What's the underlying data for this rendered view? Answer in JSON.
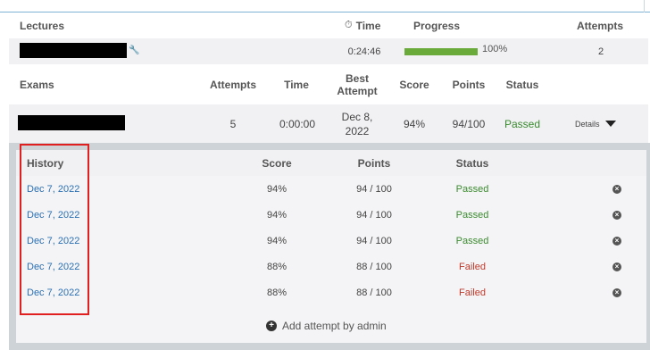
{
  "lectures_header": {
    "title": "Lectures",
    "time": "Time",
    "progress": "Progress",
    "attempts": "Attempts"
  },
  "lecture_row": {
    "time": "0:24:46",
    "progress_value": 100,
    "progress_text": "100%",
    "attempts": "2"
  },
  "exams_header": {
    "title": "Exams",
    "attempts": "Attempts",
    "time": "Time",
    "best_attempt_line1": "Best",
    "best_attempt_line2": "Attempt",
    "score": "Score",
    "points": "Points",
    "status": "Status"
  },
  "exam_row": {
    "attempts": "5",
    "time": "0:00:00",
    "best_attempt_line1": "Dec 8,",
    "best_attempt_line2": "2022",
    "score": "94%",
    "points": "94/100",
    "status": "Passed",
    "details_label": "Details"
  },
  "history_header": {
    "title": "History",
    "score": "Score",
    "points": "Points",
    "status": "Status"
  },
  "history_rows": [
    {
      "date": "Dec 7, 2022",
      "score": "94%",
      "points": "94 / 100",
      "status": "Passed"
    },
    {
      "date": "Dec 7, 2022",
      "score": "94%",
      "points": "94 / 100",
      "status": "Passed"
    },
    {
      "date": "Dec 7, 2022",
      "score": "94%",
      "points": "94 / 100",
      "status": "Passed"
    },
    {
      "date": "Dec 7, 2022",
      "score": "88%",
      "points": "88 / 100",
      "status": "Failed"
    },
    {
      "date": "Dec 7, 2022",
      "score": "88%",
      "points": "88 / 100",
      "status": "Failed"
    }
  ],
  "add_attempt_label": "Add attempt by admin",
  "colors": {
    "progress_bar": "#6aaa3a",
    "passed": "#3a8a2e",
    "failed": "#c0392b",
    "link": "#2a6fb0",
    "highlight": "#e02020"
  },
  "icons": {
    "time": "stopwatch-icon",
    "wrench": "wrench-icon",
    "remove": "remove-circle-icon",
    "add": "add-circle-icon",
    "details": "caret-down-icon"
  }
}
